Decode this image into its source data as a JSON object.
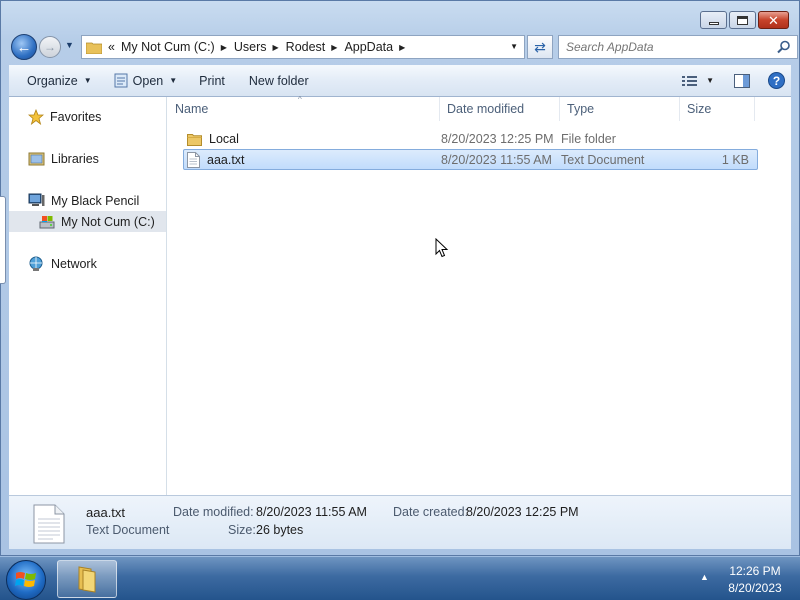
{
  "window": {
    "buttons": {
      "minimize": "minimize",
      "maximize": "maximize",
      "close": "close"
    }
  },
  "nav": {
    "overflow": "«",
    "breadcrumbs": [
      "My Not Cum (C:)",
      "Users",
      "Rodest",
      "AppData"
    ],
    "search_placeholder": "Search AppData"
  },
  "toolbar": {
    "organize": "Organize",
    "open": "Open",
    "print": "Print",
    "new_folder": "New folder"
  },
  "navpane": {
    "favorites": "Favorites",
    "libraries": "Libraries",
    "computer": "My Black Pencil",
    "drive": "My Not Cum (C:)",
    "network": "Network"
  },
  "columns": {
    "name": "Name",
    "date": "Date modified",
    "type": "Type",
    "size": "Size"
  },
  "files": [
    {
      "name": "Local",
      "date": "8/20/2023 12:25 PM",
      "type": "File folder",
      "size": "",
      "icon": "folder-icon",
      "selected": false
    },
    {
      "name": "aaa.txt",
      "date": "8/20/2023 11:55 AM",
      "type": "Text Document",
      "size": "1 KB",
      "icon": "text-file-icon",
      "selected": true
    }
  ],
  "details": {
    "name": "aaa.txt",
    "kind": "Text Document",
    "modified_label": "Date modified:",
    "modified_value": "8/20/2023 11:55 AM",
    "size_label": "Size:",
    "size_value": "26 bytes",
    "created_label": "Date created:",
    "created_value": "8/20/2023 12:25 PM"
  },
  "taskbar": {
    "time": "12:26 PM",
    "date": "8/20/2023"
  },
  "colors": {
    "selection": "#c1dcfc",
    "accent": "#2e6fc2"
  }
}
